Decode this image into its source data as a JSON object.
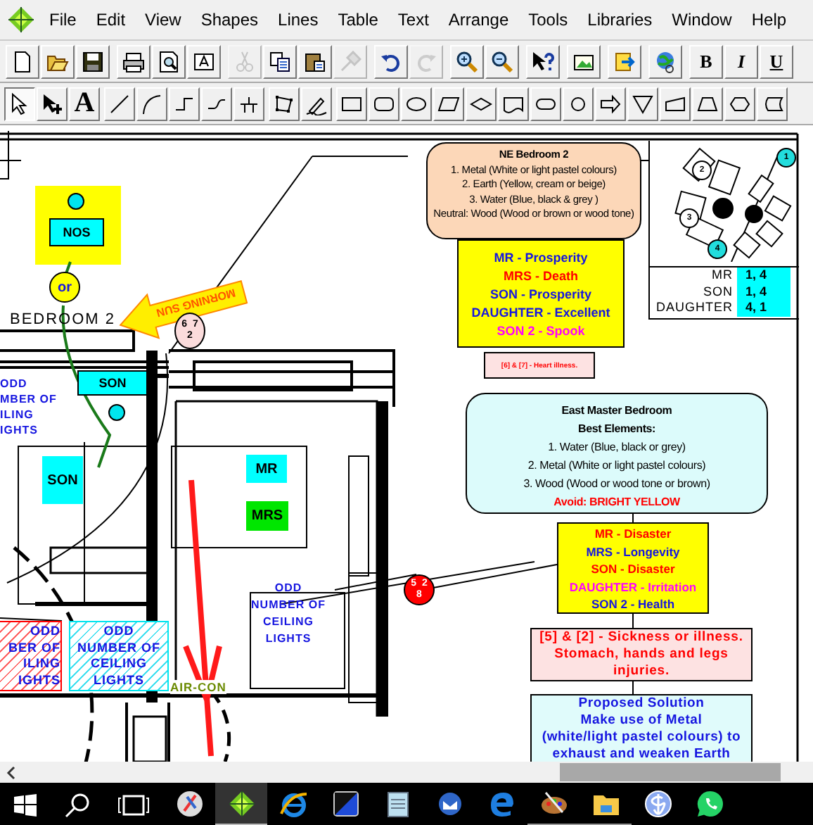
{
  "menu": [
    "File",
    "Edit",
    "View",
    "Shapes",
    "Lines",
    "Table",
    "Text",
    "Arrange",
    "Tools",
    "Libraries",
    "Window",
    "Help"
  ],
  "toolbar_1": [
    {
      "buttons": [
        {
          "kind": "new-document",
          "disabled": false
        },
        {
          "kind": "open-file",
          "disabled": false
        },
        {
          "kind": "save",
          "disabled": false
        }
      ]
    },
    {
      "buttons": [
        {
          "kind": "print",
          "disabled": false
        },
        {
          "kind": "print-preview",
          "disabled": false
        },
        {
          "kind": "text-frame",
          "disabled": false
        }
      ]
    },
    {
      "buttons": [
        {
          "kind": "cut",
          "disabled": true
        },
        {
          "kind": "copy",
          "disabled": false
        },
        {
          "kind": "paste",
          "disabled": false
        },
        {
          "kind": "format-painter",
          "disabled": true
        }
      ]
    },
    {
      "buttons": [
        {
          "kind": "undo",
          "disabled": false
        },
        {
          "kind": "redo",
          "disabled": true
        }
      ]
    },
    {
      "buttons": [
        {
          "kind": "zoom-in",
          "disabled": false
        },
        {
          "kind": "zoom-out",
          "disabled": false
        }
      ]
    },
    {
      "buttons": [
        {
          "kind": "context-help",
          "disabled": false
        }
      ]
    },
    {
      "buttons": [
        {
          "kind": "insert-picture",
          "disabled": false
        }
      ]
    },
    {
      "buttons": [
        {
          "kind": "export",
          "disabled": false
        }
      ]
    },
    {
      "buttons": [
        {
          "kind": "web-link",
          "disabled": false
        }
      ]
    },
    {
      "buttons": [
        {
          "kind": "bold",
          "label": "B",
          "disabled": false
        },
        {
          "kind": "italic",
          "label": "I",
          "disabled": false
        },
        {
          "kind": "underline",
          "label": "U",
          "disabled": false
        }
      ]
    }
  ],
  "toolbar_2": [
    {
      "buttons": [
        {
          "kind": "select-tool",
          "selected": true
        },
        {
          "kind": "add-point-tool",
          "selected": false
        },
        {
          "kind": "text-tool",
          "label": "A",
          "selected": false
        }
      ]
    },
    {
      "buttons": [
        {
          "kind": "line-tool",
          "selected": false
        },
        {
          "kind": "curve-tool",
          "selected": false
        },
        {
          "kind": "step-line-tool",
          "selected": false
        },
        {
          "kind": "step-curve-tool",
          "selected": false
        },
        {
          "kind": "connector-tool",
          "selected": false
        }
      ]
    },
    {
      "buttons": [
        {
          "kind": "polygon-tool",
          "selected": false
        },
        {
          "kind": "freehand-tool",
          "selected": false
        }
      ]
    },
    {
      "buttons": [
        {
          "kind": "rectangle-shape",
          "selected": false
        },
        {
          "kind": "rounded-rectangle-shape",
          "selected": false
        },
        {
          "kind": "ellipse-shape",
          "selected": false
        },
        {
          "kind": "parallelogram-shape",
          "selected": false
        },
        {
          "kind": "diamond-shape",
          "selected": false
        },
        {
          "kind": "document-shape",
          "selected": false
        },
        {
          "kind": "terminator-shape",
          "selected": false
        },
        {
          "kind": "circle-shape",
          "selected": false
        },
        {
          "kind": "arrow-shape",
          "selected": false
        },
        {
          "kind": "triangle-shape",
          "selected": false
        },
        {
          "kind": "manual-input-shape",
          "selected": false
        },
        {
          "kind": "trapezoid-shape",
          "selected": false
        },
        {
          "kind": "hexagon-shape",
          "selected": false
        },
        {
          "kind": "stored-data-shape",
          "selected": false
        }
      ]
    }
  ],
  "canvas": {
    "nos_label": "NOS",
    "or_label": "or",
    "room_label": "BEDROOM 2",
    "sun_arrow": "MORNING SUN",
    "star_circle_1": [
      "6  7",
      "2"
    ],
    "ne_note": {
      "title": "NE  Bedroom 2",
      "lines": [
        "1. Metal (White or light pastel colours)",
        "2. Earth (Yellow, cream or beige)",
        "3. Water (Blue, black & grey )",
        "Neutral: Wood (Wood  or brown or wood tone)"
      ]
    },
    "forecast_1": [
      {
        "text": "MR - Prosperity",
        "color": "#1515e0"
      },
      {
        "text": "MRS  - Death",
        "color": "#ff0000"
      },
      {
        "text": "SON - Prosperity",
        "color": "#1515e0"
      },
      {
        "text": "DAUGHTER - Excellent",
        "color": "#1515e0"
      },
      {
        "text": "SON 2 - Spook",
        "color": "#ff00ff"
      }
    ],
    "note_small": "[6] & [7] - Heart illness.",
    "compass_markers": [
      {
        "label": "1",
        "color": "#22dddd"
      },
      {
        "label": "2",
        "color": "#ffffff"
      },
      {
        "label": "3",
        "color": "#ffffff"
      },
      {
        "label": "4",
        "color": "#22dddd"
      }
    ],
    "direction_table": [
      {
        "name": "MR",
        "value": "1, 4"
      },
      {
        "name": "SON",
        "value": "1, 4"
      },
      {
        "name": "DAUGHTER",
        "value": "4, 1"
      }
    ],
    "lights_left_top": [
      "ODD",
      "MBER OF",
      "ILING",
      "IGHTS"
    ],
    "son_label_1": "SON",
    "son_label_2": "SON",
    "mr_label": "MR",
    "mrs_label": "MRS",
    "east_note": {
      "title": "East Master Bedroom",
      "subtitle": "Best Elements:",
      "lines": [
        "1. Water (Blue, black or grey)",
        "2. Metal (White or light pastel colours)",
        "3. Wood (Wood  or wood tone or brown)"
      ],
      "avoid": "Avoid: BRIGHT YELLOW"
    },
    "forecast_2": [
      {
        "text": "MR - Disaster",
        "color": "#ff0000"
      },
      {
        "text": "MRS - Longevity",
        "color": "#1515e0"
      },
      {
        "text": "SON - Disaster",
        "color": "#ff0000"
      },
      {
        "text": "DAUGHTER - Irritation",
        "color": "#ff00ff"
      },
      {
        "text": "SON 2 - Health",
        "color": "#1515e0"
      }
    ],
    "star_circle_2": [
      "5  2",
      "8"
    ],
    "sickness_note": "[5] & [2] - Sickness or illness. Stomach, hands and legs injuries.",
    "solution_note": [
      "Proposed Solution",
      "Make use of Metal",
      "(white/light pastel colours) to",
      "exhaust and weaken Earth"
    ],
    "lights_center": [
      "ODD",
      "NUMBER OF",
      "CEILING",
      "LIGHTS"
    ],
    "lights_red": [
      "ODD",
      "BER OF",
      "ILING",
      "IGHTS"
    ],
    "lights_cyan": [
      "ODD",
      "NUMBER OF",
      "CEILING",
      "LIGHTS"
    ],
    "aircon_label": "AIR-CON"
  },
  "taskbar": [
    {
      "kind": "paint-app",
      "selected": false,
      "open": false
    },
    {
      "kind": "diagram-app",
      "selected": true,
      "open": true
    },
    {
      "kind": "ie-browser",
      "selected": false,
      "open": false
    },
    {
      "kind": "gradient-app",
      "selected": false,
      "open": false
    },
    {
      "kind": "notepad",
      "selected": false,
      "open": false
    },
    {
      "kind": "mail-app",
      "selected": false,
      "open": false
    },
    {
      "kind": "edge-browser",
      "selected": false,
      "open": false
    },
    {
      "kind": "palette-app",
      "selected": false,
      "open": true
    },
    {
      "kind": "file-explorer",
      "selected": false,
      "open": true
    },
    {
      "kind": "link-app",
      "selected": false,
      "open": false
    },
    {
      "kind": "chat-app",
      "selected": false,
      "open": false
    }
  ]
}
